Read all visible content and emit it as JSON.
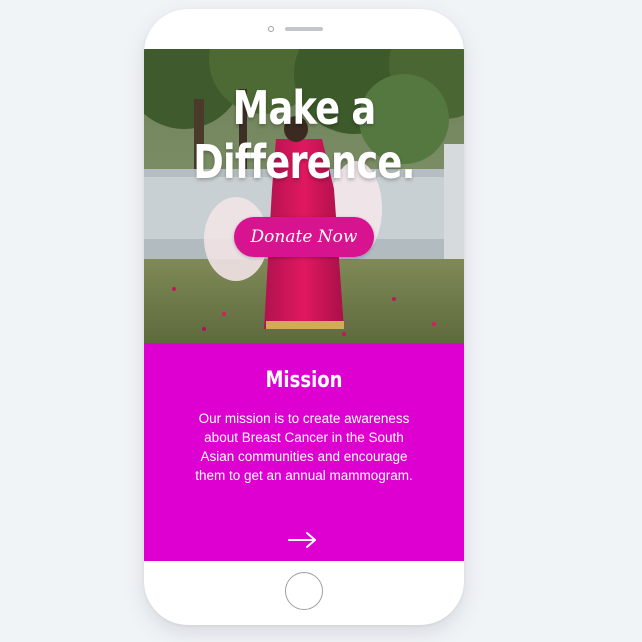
{
  "hero": {
    "headline_line1": "Make a",
    "headline_line2": "Difference.",
    "donate_label": "Donate Now",
    "background": "photo-woman-pink-dress-garden"
  },
  "mission": {
    "title": "Mission",
    "text": "Our mission is to create awareness about Breast Cancer in the South Asian communities and encourage them to get an annual mammogram.",
    "next_icon": "arrow-right-icon"
  },
  "colors": {
    "page_background": "#f1f4f7",
    "phone_frame": "#ffffff",
    "mission_background": "#dd00d0",
    "button_background": "#d8138f",
    "text": "#ffffff"
  }
}
